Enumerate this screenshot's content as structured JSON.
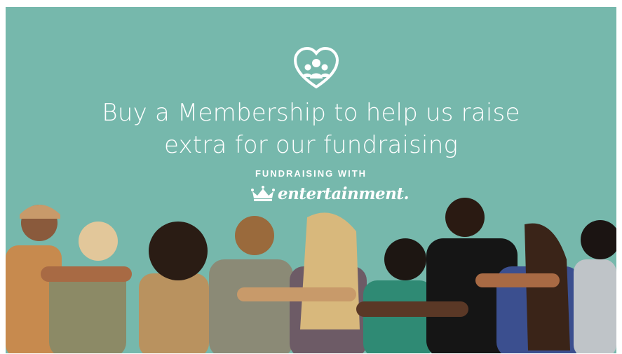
{
  "headline": {
    "line1": "Buy a Membership to help us raise",
    "line2": "extra for our fundraising"
  },
  "fundraising_label": "FUNDRAISING WITH",
  "brand": {
    "name": "entertainment.",
    "icon": "crown-icon"
  },
  "logo_icon": "heart-people-icon",
  "colors": {
    "background": "#76b8ac",
    "text": "#ffffff"
  }
}
